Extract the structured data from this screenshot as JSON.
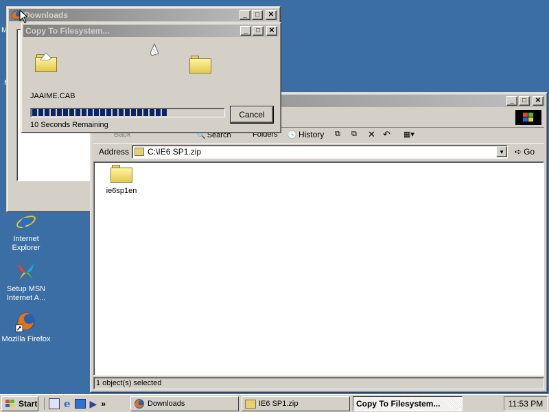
{
  "desktop": {
    "icons": [
      {
        "label": "Internet Explorer"
      },
      {
        "label": "Setup MSN Internet A..."
      },
      {
        "label": "Mozilla Firefox"
      }
    ],
    "partial_letters": [
      "M",
      "M"
    ]
  },
  "downloads_window": {
    "title": "Downloads"
  },
  "copy_dialog": {
    "title": "Copy To Filesystem...",
    "filename": "JAAIME.CAB",
    "progress": 0.71,
    "remaining": "10 Seconds Remaining",
    "cancel_label": "Cancel"
  },
  "explorer": {
    "toolbar": {
      "back_label": "Back",
      "folders_label": "Folders",
      "search_label": "Search",
      "history_label": "History"
    },
    "address_label": "Address",
    "address_value": "C:\\IE6 SP1.zip",
    "go_label": "Go",
    "items": [
      {
        "label": "ie6sp1en"
      }
    ],
    "status": "1 object(s) selected"
  },
  "taskbar": {
    "start_label": "Start",
    "chevron": "»",
    "tasks": [
      {
        "label": "Downloads"
      },
      {
        "label": "IE6 SP1.zip"
      },
      {
        "label": "Copy To Filesystem..."
      }
    ],
    "clock": "11:53 PM"
  },
  "colors": {
    "desktop": "#3a6ea5",
    "title_active": "#0a246a",
    "title_inactive": "#808080",
    "progress": "#0a246a"
  }
}
